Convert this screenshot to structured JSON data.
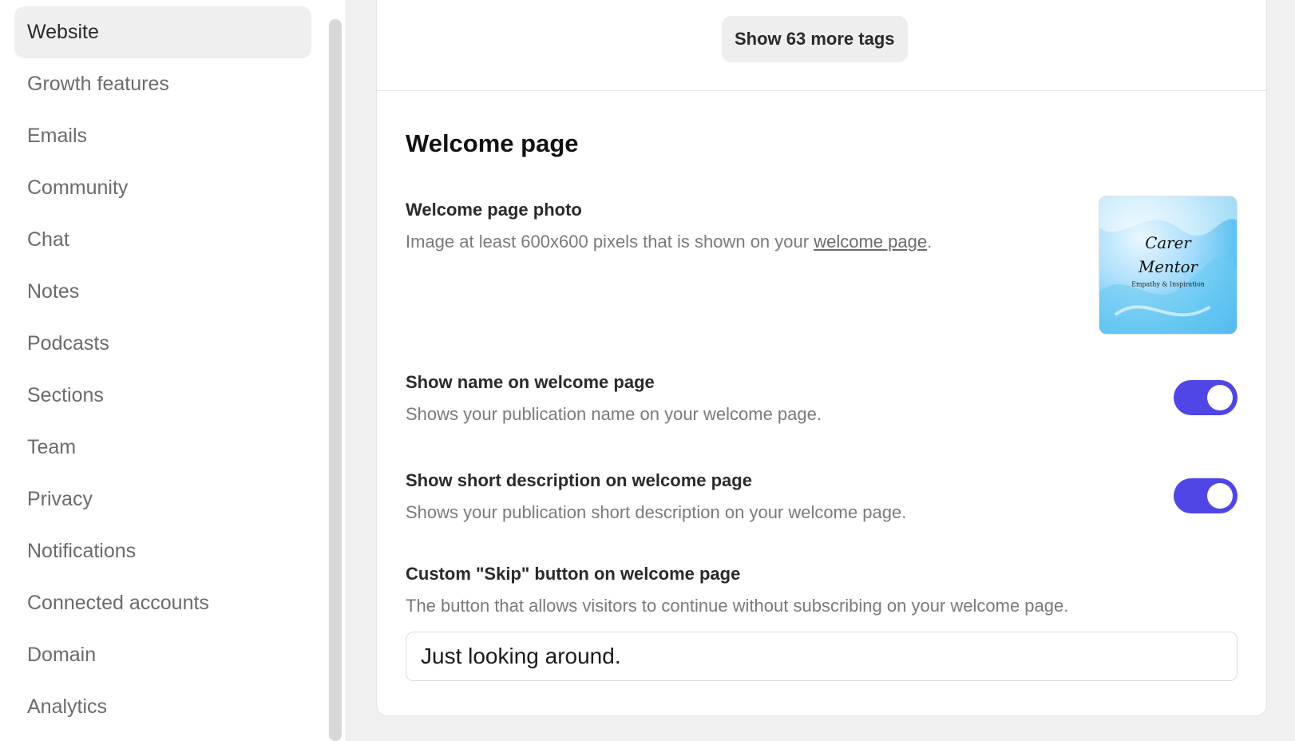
{
  "sidebar": {
    "items": [
      {
        "label": "Website",
        "active": true
      },
      {
        "label": "Growth features"
      },
      {
        "label": "Emails"
      },
      {
        "label": "Community"
      },
      {
        "label": "Chat"
      },
      {
        "label": "Notes"
      },
      {
        "label": "Podcasts"
      },
      {
        "label": "Sections"
      },
      {
        "label": "Team"
      },
      {
        "label": "Privacy"
      },
      {
        "label": "Notifications"
      },
      {
        "label": "Connected accounts"
      },
      {
        "label": "Domain"
      },
      {
        "label": "Analytics"
      }
    ]
  },
  "tags": {
    "show_more_label": "Show 63 more tags"
  },
  "welcome": {
    "title": "Welcome page",
    "photo": {
      "label": "Welcome page photo",
      "desc_prefix": "Image at least 600x600 pixels that is shown on your ",
      "link_text": "welcome page",
      "desc_suffix": ".",
      "thumb_text_line1": "Carer",
      "thumb_text_line2": "Mentor",
      "thumb_tagline": "Empathy & Inspiration"
    },
    "show_name": {
      "label": "Show name on welcome page",
      "desc": "Shows your publication name on your welcome page.",
      "enabled": true
    },
    "show_desc": {
      "label": "Show short description on welcome page",
      "desc": "Shows your publication short description on your welcome page.",
      "enabled": true
    },
    "skip_button": {
      "label": "Custom \"Skip\" button on welcome page",
      "desc": "The button that allows visitors to continue without subscribing on your welcome page.",
      "value": "Just looking around."
    }
  },
  "colors": {
    "toggle_on": "#4f46e5",
    "active_item_bg": "#efefef"
  }
}
